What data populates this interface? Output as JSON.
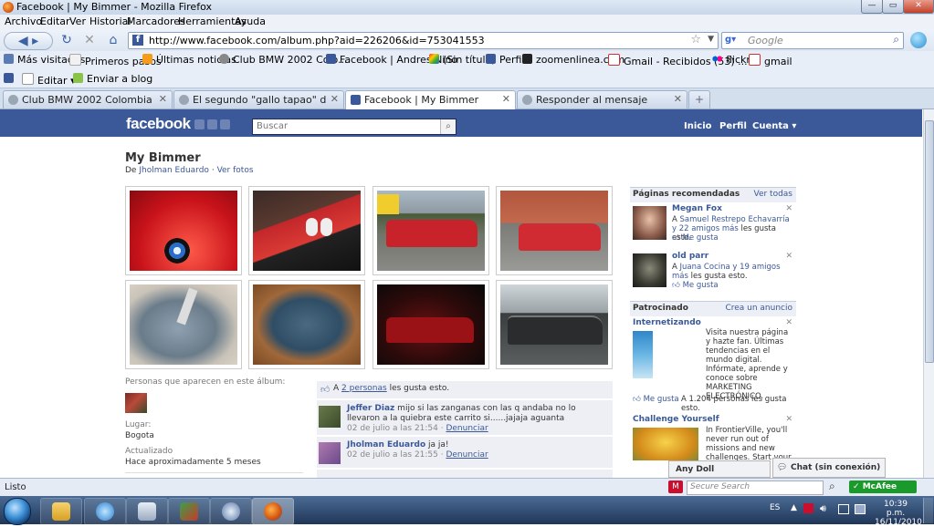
{
  "window": {
    "title": "Facebook | My Bimmer - Mozilla Firefox"
  },
  "menu": [
    "Archivo",
    "Editar",
    "Ver",
    "Historial",
    "Marcadores",
    "Herramientas",
    "Ayuda"
  ],
  "nav": {
    "url": "http://www.facebook.com/album.php?aid=226206&id=753041553",
    "search_placeholder": "Google"
  },
  "bookmarks": [
    "Más visitados",
    "Primeros pasos",
    "Últimas noticias",
    "Club BMW 2002 Colo...",
    "Facebook | Andres Nino",
    "(Sin título)",
    "Perfil",
    "zoomenlinea.com",
    "Gmail - Recibidos (53) ...",
    "flickr",
    "gmail"
  ],
  "toolbar2": {
    "edit": "Editar",
    "send": "Enviar a blog"
  },
  "tabs": [
    {
      "label": "Club BMW 2002 Colombia :: | Reviv..."
    },
    {
      "label": "El segundo \"gallo tapao\" del Presi...."
    },
    {
      "label": "Facebook | My Bimmer"
    },
    {
      "label": "Responder al mensaje"
    }
  ],
  "fb": {
    "logo": "facebook",
    "search_placeholder": "Buscar",
    "nav": [
      "Inicio",
      "Perfil",
      "Cuenta ▾"
    ]
  },
  "album": {
    "title": "My Bimmer",
    "by_prefix": "De",
    "author": "Jholman Eduardo",
    "sep": "·",
    "see_photos": "Ver fotos"
  },
  "info": {
    "people_label": "Personas que aparecen en este álbum:",
    "place_label": "Lugar:",
    "place": "Bogota",
    "updated_label": "Actualizado",
    "updated": "Hace aproximadamente 5 meses"
  },
  "likes": {
    "prefix": "A",
    "link": "2 personas",
    "suffix": "les gusta esto."
  },
  "comments": [
    {
      "name": "Jeffer Diaz",
      "text": "mijo si las zanganas con las q andaba no lo llevaron a la quiebra este carrito si......jajaja aguanta",
      "date": "02 de julio a las 21:54",
      "action": "Denunciar"
    },
    {
      "name": "Jholman Eduardo",
      "text": "ja ja!",
      "date": "02 de julio a las 21:55",
      "action": "Denunciar"
    }
  ],
  "sidebar": {
    "rec_title": "Páginas recomendadas",
    "rec_all": "Ver todas",
    "recs": [
      {
        "name": "Megan Fox",
        "desc_prefix": "A",
        "desc_link": "Samuel Restrepo Echavarría y 22 amigos más",
        "desc_suffix": "les gusta esto.",
        "like": "Me gusta"
      },
      {
        "name": "old parr",
        "desc_prefix": "A",
        "desc_link": "Juana Cocina y 19 amigos más",
        "desc_suffix": "les gusta esto.",
        "like": "Me gusta"
      }
    ],
    "sponsored_title": "Patrocinado",
    "create_ad": "Crea un anuncio",
    "ads": [
      {
        "title": "Internetizando",
        "text": "Visita nuestra página y hazte fan. Últimas tendencias en el mundo digital. Infórmate, aprende y conoce sobre MARKETING ELECTRÓNICO.",
        "like": "Me gusta",
        "like_count": "A 1.204 personas les gusta esto."
      },
      {
        "title": "Challenge Yourself",
        "text": "In FrontierVille, you'll never run out of missions and new challenges. Start your homesteadin' - play"
      }
    ]
  },
  "chat": {
    "anydoll": "Any Doll",
    "chat": "Chat (sin conexión)"
  },
  "status": {
    "text": "Listo",
    "secure_search": "Secure Search",
    "mcafee": "McAfee"
  },
  "tray": {
    "lang": "ES",
    "time": "10:39 p.m.",
    "date": "16/11/2010"
  }
}
